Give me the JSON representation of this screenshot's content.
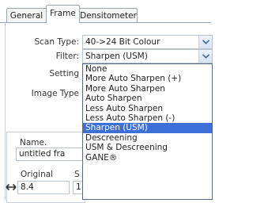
{
  "tabs": [
    {
      "label": "General"
    },
    {
      "label": "Frame"
    },
    {
      "label": "Densitometer"
    }
  ],
  "form": {
    "scan_type_label": "Scan Type:",
    "scan_type_value": "40->24 Bit Colour",
    "filter_label": "Filter:",
    "filter_value": "Sharpen (USM)",
    "setting_label": "Setting",
    "image_type_label": "Image Type"
  },
  "filter_options": [
    "None",
    "More Auto Sharpen (+)",
    "More Auto Sharpen",
    "Auto Sharpen",
    "Less Auto Sharpen",
    "Less Auto Sharpen (-)",
    "Sharpen (USM)",
    "Descreening",
    "USM & Descreening",
    "GANE®"
  ],
  "selected_filter_index": 6,
  "frame": {
    "name_label": "Name.",
    "name_value": "untitled fra",
    "original_label": "Original",
    "original_s_label": "S",
    "width_value": "8.4",
    "second_value": "1"
  },
  "colors": {
    "highlight": "#3d6fd7",
    "combo_border": "#b9c3cd",
    "arrow": "#3f5f9f"
  },
  "icons": {
    "combo_arrow": "chevron-down-icon",
    "width": "horizontal-arrows-icon"
  }
}
